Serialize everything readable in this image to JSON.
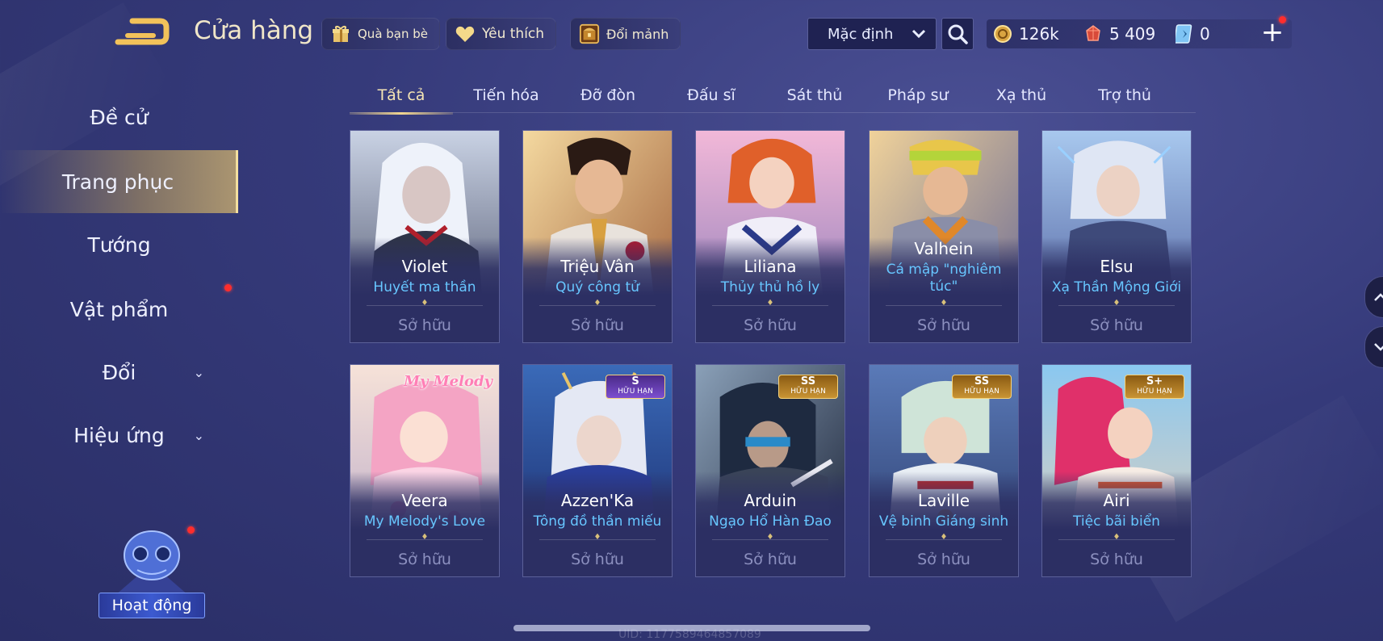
{
  "header": {
    "title": "Cửa hàng",
    "actions": [
      {
        "label": "Quà bạn bè",
        "icon": "gift-icon"
      },
      {
        "label": "Yêu thích",
        "icon": "heart-icon"
      },
      {
        "label": "Đổi mảnh",
        "icon": "treasure-chest-icon"
      }
    ],
    "sort_label": "Mặc định"
  },
  "currencies": {
    "gold": "126k",
    "vouchers": "5 409",
    "crystals": "0"
  },
  "sidebar": {
    "items": [
      {
        "label": "Đề cử",
        "active": false,
        "expandable": false
      },
      {
        "label": "Trang phục",
        "active": true,
        "expandable": false
      },
      {
        "label": "Tướng",
        "active": false,
        "expandable": false
      },
      {
        "label": "Vật phẩm",
        "active": false,
        "expandable": false
      },
      {
        "label": "Đổi",
        "active": false,
        "expandable": true
      },
      {
        "label": "Hiệu ứng",
        "active": false,
        "expandable": true
      }
    ],
    "activity_label": "Hoạt động"
  },
  "tabs": [
    "Tất cả",
    "Tiến hóa",
    "Đỡ đòn",
    "Đấu sĩ",
    "Sát thủ",
    "Pháp sư",
    "Xạ thủ",
    "Trợ thủ"
  ],
  "active_tab": 0,
  "skins": [
    {
      "hero": "Violet",
      "skin": "Huyết ma thần",
      "status": "Sở hữu",
      "badge": null
    },
    {
      "hero": "Triệu Vân",
      "skin": "Quý công tử",
      "status": "Sở hữu",
      "badge": null
    },
    {
      "hero": "Liliana",
      "skin": "Thủy thủ hồ ly",
      "status": "Sở hữu",
      "badge": null
    },
    {
      "hero": "Valhein",
      "skin": "Cá mập \"nghiêm túc\"",
      "status": "Sở hữu",
      "badge": null
    },
    {
      "hero": "Elsu",
      "skin": "Xạ Thần Mộng Giới",
      "status": "Sở hữu",
      "badge": null
    },
    {
      "hero": "Veera",
      "skin": "My Melody's Love",
      "status": "Sở hữu",
      "badge": null,
      "logo": "My Melody"
    },
    {
      "hero": "Azzen'Ka",
      "skin": "Tông đồ thần miếu",
      "status": "Sở hữu",
      "badge": {
        "tier": "S",
        "sub": "HỮU HẠN",
        "style": "purple"
      }
    },
    {
      "hero": "Arduin",
      "skin": "Ngạo Hổ Hàn Đao",
      "status": "Sở hữu",
      "badge": {
        "tier": "SS",
        "sub": "HỮU HẠN",
        "style": "gold"
      }
    },
    {
      "hero": "Laville",
      "skin": "Vệ binh Giáng sinh",
      "status": "Sở hữu",
      "badge": {
        "tier": "SS",
        "sub": "HỮU HẠN",
        "style": "gold"
      }
    },
    {
      "hero": "Airi",
      "skin": "Tiệc bãi biển",
      "status": "Sở hữu",
      "badge": {
        "tier": "S+",
        "sub": "HỮU HẠN",
        "style": "gold"
      }
    }
  ],
  "footer": {
    "uid": "UID: 1177589464857089"
  },
  "colors": {
    "accent_gold": "#f3d790",
    "skin_name": "#67c6ff",
    "background": "#353a7a",
    "notification": "#ff2d2d"
  }
}
